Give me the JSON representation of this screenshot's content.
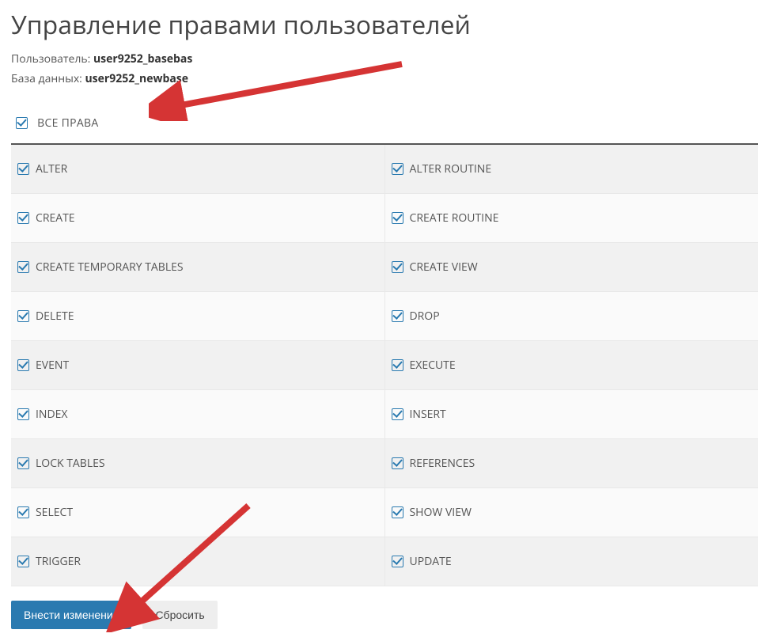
{
  "page_title": "Управление правами пользователей",
  "user_label": "Пользователь: ",
  "user_value": "user9252_basebas",
  "db_label": "База данных: ",
  "db_value": "user9252_newbase",
  "all_rights_label": "ВСЕ ПРАВА",
  "permissions_left": [
    "ALTER",
    "CREATE",
    "CREATE TEMPORARY TABLES",
    "DELETE",
    "EVENT",
    "INDEX",
    "LOCK TABLES",
    "SELECT",
    "TRIGGER"
  ],
  "permissions_right": [
    "ALTER ROUTINE",
    "CREATE ROUTINE",
    "CREATE VIEW",
    "DROP",
    "EXECUTE",
    "INSERT",
    "REFERENCES",
    "SHOW VIEW",
    "UPDATE"
  ],
  "buttons": {
    "submit": "Внести изменения",
    "reset": "Сбросить"
  }
}
